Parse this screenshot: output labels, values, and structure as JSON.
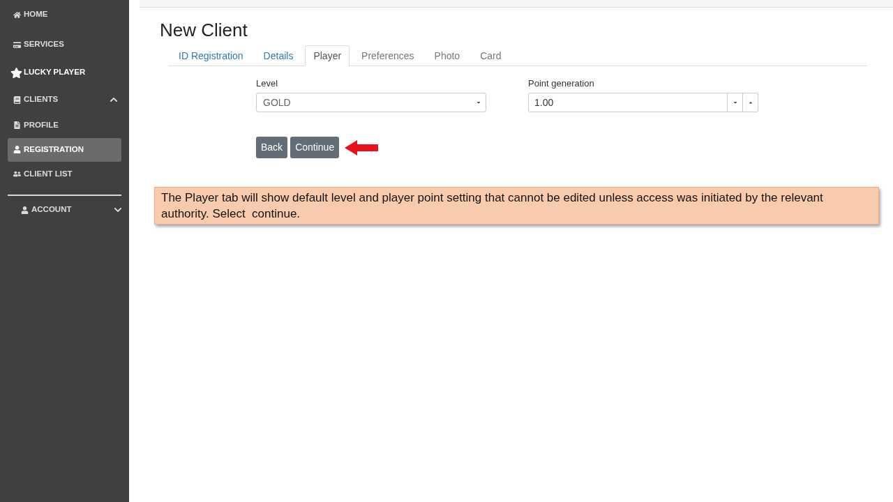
{
  "sidebar": {
    "items": [
      {
        "label": "HOME",
        "kind": "link",
        "selected": false
      },
      {
        "label": "SERVICES",
        "kind": "link",
        "selected": false
      },
      {
        "label": "LUCKY PLAYER",
        "kind": "featured",
        "selected": false
      },
      {
        "label": "CLIENTS",
        "kind": "group",
        "expanded": true,
        "children": [
          {
            "label": "PROFILE",
            "selected": false
          },
          {
            "label": "REGISTRATION",
            "selected": true
          },
          {
            "label": "CLIENT LIST",
            "selected": false
          }
        ]
      }
    ],
    "account": {
      "label": "ACCOUNT",
      "expanded": false
    }
  },
  "page": {
    "title": "New Client"
  },
  "tabs": [
    {
      "label": "ID Registration",
      "selected": false,
      "disabled": false
    },
    {
      "label": "Details",
      "selected": false,
      "disabled": false
    },
    {
      "label": "Player",
      "selected": true,
      "disabled": false
    },
    {
      "label": "Preferences",
      "selected": false,
      "disabled": true
    },
    {
      "label": "Photo",
      "selected": false,
      "disabled": true
    },
    {
      "label": "Card",
      "selected": false,
      "disabled": true
    }
  ],
  "form": {
    "fields": [
      {
        "kind": "select",
        "label": "Level",
        "value": "GOLD"
      },
      {
        "kind": "spinner",
        "label": "Point generation",
        "value": "1.00"
      }
    ]
  },
  "buttons": [
    "Back",
    "Continue"
  ],
  "callout": {
    "text": "The Player tab will show default level and player point setting that cannot be edited unless access was initiated by the relevant authority. Select  continue."
  }
}
